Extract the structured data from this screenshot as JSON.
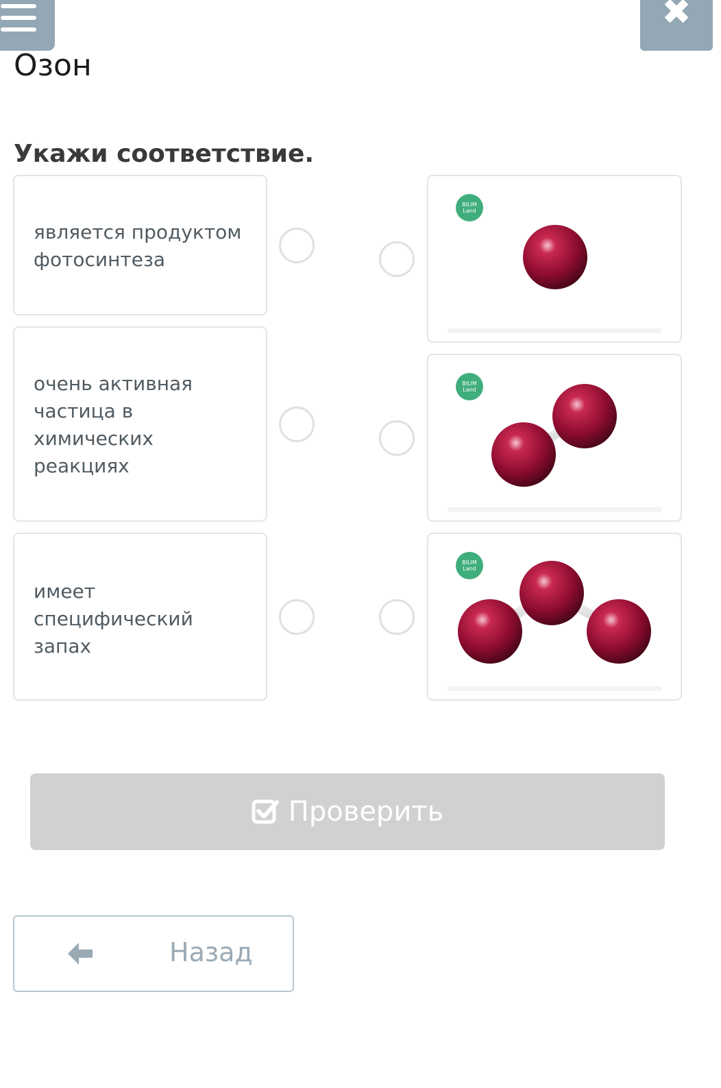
{
  "header": {
    "menu_icon": "menu-icon",
    "close_icon": "close-icon",
    "title": "Озон"
  },
  "task": {
    "prompt": "Укажи соответствие."
  },
  "statements": [
    {
      "text": "является продуктом фотосинтеза"
    },
    {
      "text": "очень активная частица в химических реакциях"
    },
    {
      "text": "имеет специфический запах"
    }
  ],
  "images": [
    {
      "badge": [
        "BILIM",
        "Land"
      ],
      "molecule": "single-atom"
    },
    {
      "badge": [
        "BILIM",
        "Land"
      ],
      "molecule": "diatomic"
    },
    {
      "badge": [
        "BILIM",
        "Land"
      ],
      "molecule": "triatomic"
    }
  ],
  "actions": {
    "check_label": "Проверить",
    "back_label": "Назад"
  },
  "colors": {
    "accent": "#93a7b4",
    "atom": "#a3103a",
    "badge": "#3fae7c",
    "disabled_button": "#d1d1d1"
  }
}
